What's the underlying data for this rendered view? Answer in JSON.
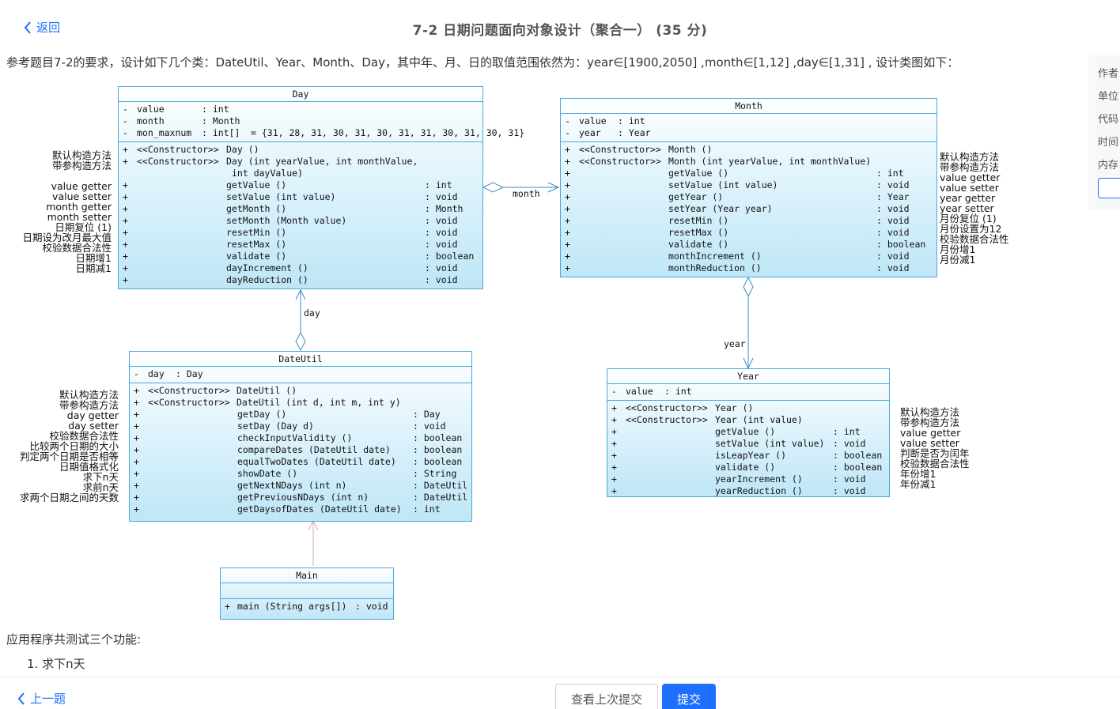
{
  "header": {
    "back_label": "返回",
    "title": "7-2 日期问题面向对象设计（聚合一） (35 分)"
  },
  "intro": "参考题目7-2的要求，设计如下几个类：DateUtil、Year、Month、Day，其中年、月、日的取值范围依然为：year∈[1900,2050] ,month∈[1,12] ,day∈[1,31] , 设计类图如下：",
  "side_panel": {
    "labels": [
      "作者",
      "单位",
      "代码",
      "时间",
      "内存"
    ]
  },
  "diagram": {
    "day_class": {
      "name": "Day",
      "attributes": [
        {
          "vis": "-",
          "name": "value",
          "type": ": int",
          "extra": ""
        },
        {
          "vis": "-",
          "name": "month",
          "type": ": Month",
          "extra": ""
        },
        {
          "vis": "-",
          "name": "mon_maxnum",
          "type": ": int[]",
          "extra": "= {31, 28, 31, 30, 31, 30, 31, 31, 30, 31, 30, 31}"
        }
      ],
      "constructors": [
        {
          "vis": "+",
          "stereo": "<<Constructor>>",
          "sig": "Day ()",
          "cont": ""
        },
        {
          "vis": "+",
          "stereo": "<<Constructor>>",
          "sig": "Day (int yearValue, int monthValue,",
          "cont": "int dayValue)"
        }
      ],
      "methods": [
        {
          "vis": "+",
          "sig": "getValue ()",
          "ret": ": int"
        },
        {
          "vis": "+",
          "sig": "setValue (int value)",
          "ret": ": void"
        },
        {
          "vis": "+",
          "sig": "getMonth ()",
          "ret": ": Month"
        },
        {
          "vis": "+",
          "sig": "setMonth (Month value)",
          "ret": ": void"
        },
        {
          "vis": "+",
          "sig": "resetMin ()",
          "ret": ": void"
        },
        {
          "vis": "+",
          "sig": "resetMax ()",
          "ret": ": void"
        },
        {
          "vis": "+",
          "sig": "validate ()",
          "ret": ": boolean"
        },
        {
          "vis": "+",
          "sig": "dayIncrement ()",
          "ret": ": void"
        },
        {
          "vis": "+",
          "sig": "dayReduction ()",
          "ret": ": void"
        }
      ],
      "notes": [
        "默认构造方法",
        "带参构造方法",
        "",
        "value getter",
        "value setter",
        "month getter",
        "month setter",
        "日期复位 (1)",
        "日期设为改月最大值",
        "校验数据合法性",
        "日期增1",
        "日期减1"
      ]
    },
    "month_class": {
      "name": "Month",
      "attributes": [
        {
          "vis": "-",
          "name": "value",
          "type": ": int"
        },
        {
          "vis": "-",
          "name": "year",
          "type": ": Year"
        }
      ],
      "constructors": [
        {
          "vis": "+",
          "stereo": "<<Constructor>>",
          "sig": "Month ()"
        },
        {
          "vis": "+",
          "stereo": "<<Constructor>>",
          "sig": "Month (int yearValue, int monthValue)"
        }
      ],
      "methods": [
        {
          "vis": "+",
          "sig": "getValue ()",
          "ret": ": int"
        },
        {
          "vis": "+",
          "sig": "setValue (int value)",
          "ret": ": void"
        },
        {
          "vis": "+",
          "sig": "getYear ()",
          "ret": ": Year"
        },
        {
          "vis": "+",
          "sig": "setYear (Year year)",
          "ret": ": void"
        },
        {
          "vis": "+",
          "sig": "resetMin ()",
          "ret": ": void"
        },
        {
          "vis": "+",
          "sig": "resetMax ()",
          "ret": ": void"
        },
        {
          "vis": "+",
          "sig": "validate ()",
          "ret": ": boolean"
        },
        {
          "vis": "+",
          "sig": "monthIncrement ()",
          "ret": ": void"
        },
        {
          "vis": "+",
          "sig": "monthReduction ()",
          "ret": ": void"
        }
      ],
      "notes": [
        "默认构造方法",
        "带参构造方法",
        "value getter",
        "value setter",
        "year getter",
        "year setter",
        "月份复位 (1)",
        "月份设置为12",
        "校验数据合法性",
        "月份增1",
        "月份减1"
      ]
    },
    "year_class": {
      "name": "Year",
      "attributes": [
        {
          "vis": "-",
          "name": "value",
          "type": ": int"
        }
      ],
      "constructors": [
        {
          "vis": "+",
          "stereo": "<<Constructor>>",
          "sig": "Year ()"
        },
        {
          "vis": "+",
          "stereo": "<<Constructor>>",
          "sig": "Year (int value)"
        }
      ],
      "methods": [
        {
          "vis": "+",
          "sig": "getValue ()",
          "ret": ": int"
        },
        {
          "vis": "+",
          "sig": "setValue (int value)",
          "ret": ": void"
        },
        {
          "vis": "+",
          "sig": "isLeapYear ()",
          "ret": ": boolean"
        },
        {
          "vis": "+",
          "sig": "validate ()",
          "ret": ": boolean"
        },
        {
          "vis": "+",
          "sig": "yearIncrement ()",
          "ret": ": void"
        },
        {
          "vis": "+",
          "sig": "yearReduction ()",
          "ret": ": void"
        }
      ],
      "notes": [
        "默认构造方法",
        "带参构造方法",
        "value getter",
        "value setter",
        "判断是否为闰年",
        "校验数据合法性",
        "年份增1",
        "年份减1"
      ]
    },
    "dateutil_class": {
      "name": "DateUtil",
      "attributes": [
        {
          "vis": "-",
          "name": "day",
          "type": ": Day"
        }
      ],
      "constructors": [
        {
          "vis": "+",
          "stereo": "<<Constructor>>",
          "sig": "DateUtil ()"
        },
        {
          "vis": "+",
          "stereo": "<<Constructor>>",
          "sig": "DateUtil (int d, int m, int y)"
        }
      ],
      "methods": [
        {
          "vis": "+",
          "sig": "getDay ()",
          "ret": ": Day"
        },
        {
          "vis": "+",
          "sig": "setDay (Day d)",
          "ret": ": void"
        },
        {
          "vis": "+",
          "sig": "checkInputValidity ()",
          "ret": ": boolean"
        },
        {
          "vis": "+",
          "sig": "compareDates (DateUtil date)",
          "ret": ": boolean"
        },
        {
          "vis": "+",
          "sig": "equalTwoDates (DateUtil date)",
          "ret": ": boolean"
        },
        {
          "vis": "+",
          "sig": "showDate ()",
          "ret": ": String"
        },
        {
          "vis": "+",
          "sig": "getNextNDays (int n)",
          "ret": ": DateUtil"
        },
        {
          "vis": "+",
          "sig": "getPreviousNDays (int n)",
          "ret": ": DateUtil"
        },
        {
          "vis": "+",
          "sig": "getDaysofDates (DateUtil date)",
          "ret": ": int"
        }
      ],
      "notes": [
        "默认构造方法",
        "带参构造方法",
        "day getter",
        "day setter",
        "校验数据合法性",
        "比较两个日期的大小",
        "判定两个日期是否相等",
        "日期值格式化",
        "求下n天",
        "求前n天",
        "求两个日期之间的天数"
      ]
    },
    "main_class": {
      "name": "Main",
      "methods": [
        {
          "vis": "+",
          "sig": "main (String args[])",
          "ret": ": void"
        }
      ]
    },
    "connectors": {
      "month_label": "month",
      "day_label": "day",
      "year_label": "year"
    }
  },
  "body": {
    "functions_heading": "应用程序共测试三个功能:",
    "item1": "1. 求下n天"
  },
  "footer": {
    "prev_label": "上一题",
    "history_label": "查看上次提交",
    "submit_label": "提交"
  },
  "colors": {
    "accent": "#1f6fff",
    "uml_border": "#4aa9d6"
  }
}
